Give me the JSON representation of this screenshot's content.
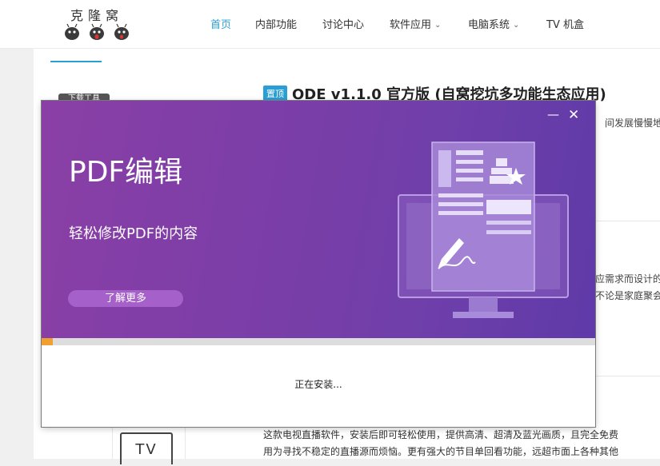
{
  "site": {
    "logo_text": "克隆窝",
    "nav": [
      {
        "label": "首页",
        "active": true
      },
      {
        "label": "内部功能"
      },
      {
        "label": "讨论中心"
      },
      {
        "label": "软件应用",
        "dropdown": true
      },
      {
        "label": "电脑系统",
        "dropdown": true
      },
      {
        "label": "TV 机盒"
      }
    ],
    "side_tag": "下载工具",
    "post": {
      "badge": "置顶",
      "title": "ODE v1.1.0 官方版 (自窝挖坑多功能生态应用)"
    },
    "snippets": {
      "s1": "间发展慢慢地",
      "s2": "应需求而设计的",
      "s3": "不论是家庭聚会"
    },
    "tv_label": "TV",
    "bottom_lines": [
      "这款电视直播软件，安装后即可轻松使用，提供高清、超清及蓝光画质，且完全免费",
      "用为寻找不稳定的直播源而烦恼。更有强大的节目单回看功能，远超市面上各种其他"
    ]
  },
  "installer": {
    "minimize_icon": "minimize-icon",
    "close_icon": "close-icon",
    "title": "PDF编辑",
    "subtitle": "轻松修改PDF的内容",
    "learn_more": "了解更多",
    "progress": 0.02,
    "status": "正在安装...",
    "colors": {
      "banner": "#7a3ea8",
      "button": "#a660c9",
      "progress": "#f0a030",
      "accent": "#2a9fd6"
    }
  }
}
